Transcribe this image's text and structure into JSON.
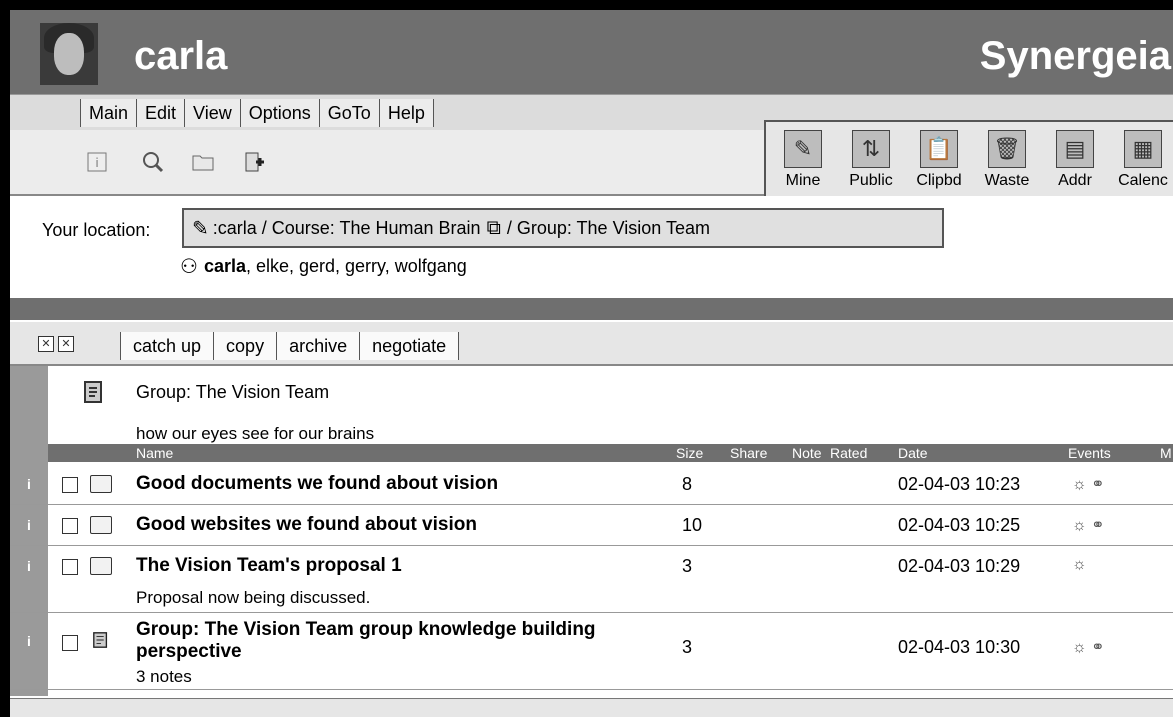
{
  "header": {
    "username": "carla",
    "app_name": "Synergeia"
  },
  "menu": [
    "Main",
    "Edit",
    "View",
    "Options",
    "GoTo",
    "Help"
  ],
  "toolbar_big": [
    {
      "label": "Mine",
      "icon": "mine-icon"
    },
    {
      "label": "Public",
      "icon": "public-icon"
    },
    {
      "label": "Clipbd",
      "icon": "clipboard-icon"
    },
    {
      "label": "Waste",
      "icon": "wastebasket-icon"
    },
    {
      "label": "Addr",
      "icon": "address-book-icon"
    },
    {
      "label": "Calenc",
      "icon": "calendar-icon"
    }
  ],
  "location": {
    "label": "Your location:",
    "path_user": ":carla / Course: The Human Brain",
    "path_group": "/ Group: The Vision Team",
    "members_bold": "carla",
    "members_rest": ", elke, gerd, gerry, wolfgang"
  },
  "actions": [
    "catch up",
    "copy",
    "archive",
    "negotiate"
  ],
  "group": {
    "title": "Group: The Vision Team",
    "description": "how our eyes see for our brains"
  },
  "table": {
    "columns": {
      "name": "Name",
      "size": "Size",
      "share": "Share",
      "note": "Note",
      "rated": "Rated",
      "date": "Date",
      "events": "Events",
      "more": "M"
    },
    "rows": [
      {
        "name": "Good documents we found about vision",
        "size": "8",
        "date": "02-04-03 10:23",
        "sub": ""
      },
      {
        "name": "Good websites we found about vision",
        "size": "10",
        "date": "02-04-03 10:25",
        "sub": ""
      },
      {
        "name": "The Vision Team's proposal 1",
        "size": "3",
        "date": "02-04-03 10:29",
        "sub": "Proposal now being discussed."
      },
      {
        "name": "Group: The Vision Team group knowledge building perspective",
        "size": "3",
        "date": "02-04-03 10:30",
        "sub": "3 notes"
      }
    ]
  },
  "info_glyph": "i"
}
